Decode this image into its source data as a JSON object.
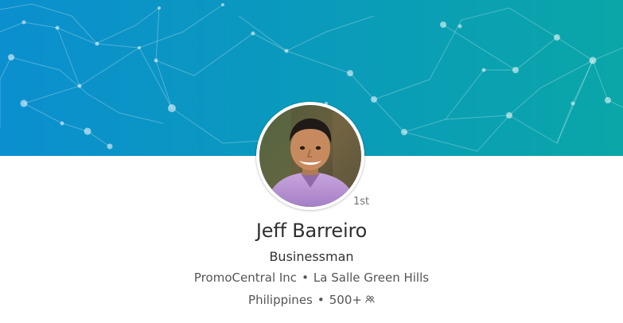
{
  "profile": {
    "degree": "1st",
    "name": "Jeff Barreiro",
    "headline": "Businessman",
    "company": "PromoCentral Inc",
    "school": "La Salle Green Hills",
    "location": "Philippines",
    "connections": "500+",
    "connections_icon": "connections-icon",
    "separator": "•"
  },
  "colors": {
    "banner_left": "#0b8fcf",
    "banner_right": "#0aa6a8",
    "text_primary": "#2f2f2f",
    "text_secondary": "#555555"
  }
}
